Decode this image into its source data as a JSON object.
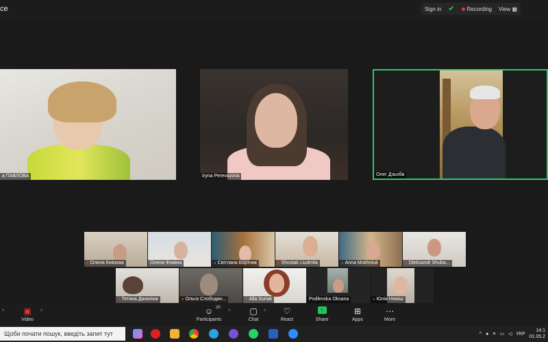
{
  "app": {
    "title": "ce"
  },
  "topbar": {
    "sign_in": "Sign in",
    "recording": "Recording",
    "view": "View"
  },
  "speakers": [
    {
      "name": "а ПАВЛОВА"
    },
    {
      "name": "Iryna Perevozova"
    },
    {
      "name": "Олег Дзьоба"
    }
  ],
  "gallery_row1": [
    {
      "name": "Олена Князєва"
    },
    {
      "name": "Олена Фоміна"
    },
    {
      "name": "Світлана Бортник"
    },
    {
      "name": "Shostak Liudmila"
    },
    {
      "name": "Anna Mokhniuk"
    },
    {
      "name": "Oleksandr Shuba..."
    }
  ],
  "gallery_row2": [
    {
      "name": "Тетяна Данилюк"
    },
    {
      "name": "Ольга Слободян..."
    },
    {
      "name": "Alla Suriak"
    },
    {
      "name": "Podlevska Oksana"
    },
    {
      "name": "Юлія Неміш"
    }
  ],
  "toolbar": {
    "video": "Video",
    "participants": "Participants",
    "participants_count": "20",
    "chat": "Chat",
    "react": "React",
    "share": "Share",
    "apps": "Apps",
    "more": "More"
  },
  "taskbar": {
    "search_placeholder": "Щоби почати пошук, введіть запит тут",
    "lang": "УКР",
    "time": "14:1",
    "date": "01.05.2"
  }
}
